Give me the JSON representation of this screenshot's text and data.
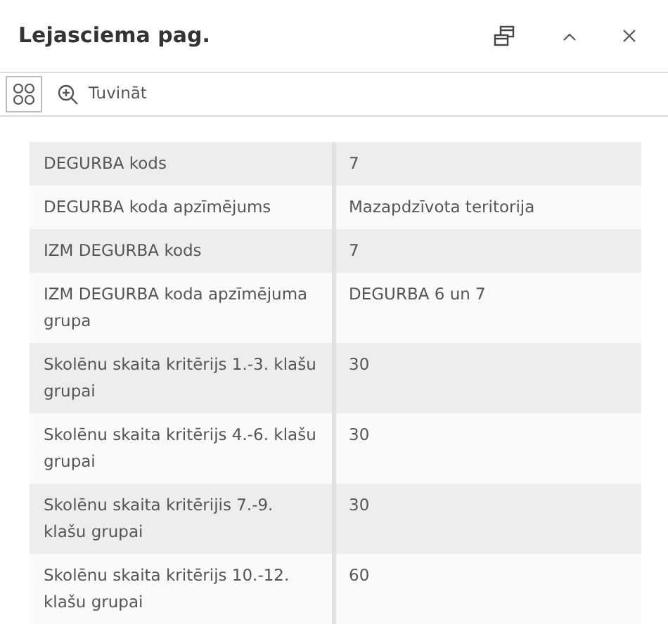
{
  "window": {
    "title": "Lejasciema pag."
  },
  "toolbar": {
    "zoom_label": "Tuvināt"
  },
  "table": {
    "rows": [
      {
        "field": "DEGURBA kods",
        "value": "7"
      },
      {
        "field": "DEGURBA koda apzīmējums",
        "value": "Mazapdzīvota teritorija"
      },
      {
        "field": "IZM DEGURBA kods",
        "value": "7"
      },
      {
        "field": "IZM DEGURBA koda apzīmējuma grupa",
        "value": "DEGURBA 6 un 7"
      },
      {
        "field": "Skolēnu skaita kritērijs 1.-3. klašu grupai",
        "value": "30"
      },
      {
        "field": "Skolēnu skaita kritērijs 4.-6. klašu grupai",
        "value": "30"
      },
      {
        "field": "Skolēnu skaita kritērijis 7.-9. klašu grupai",
        "value": "30"
      },
      {
        "field": "Skolēnu skaita kritērijs 10.-12. klašu grupai",
        "value": "60"
      }
    ]
  }
}
